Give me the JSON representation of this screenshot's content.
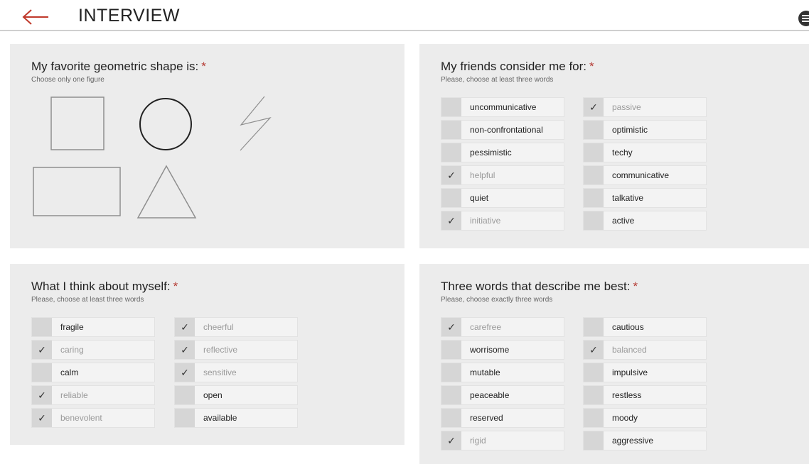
{
  "header": {
    "title": "INTERVIEW",
    "back_icon": "arrow-left-icon",
    "menu_icon": "menu-icon",
    "accent_color": "#c0392b"
  },
  "shape_card": {
    "title": "My favorite geometric shape is:",
    "required_mark": "*",
    "subtitle": "Choose only one figure",
    "shapes": [
      "square",
      "circle",
      "zigzag",
      "rectangle",
      "triangle"
    ],
    "selected": "circle"
  },
  "friends_card": {
    "title": "My friends consider me for:",
    "required_mark": "*",
    "subtitle": "Please, choose at least three words",
    "options": [
      {
        "label": "uncommunicative",
        "checked": false
      },
      {
        "label": "non-confrontational",
        "checked": false
      },
      {
        "label": "pessimistic",
        "checked": false
      },
      {
        "label": "helpful",
        "checked": true
      },
      {
        "label": "quiet",
        "checked": false
      },
      {
        "label": "initiative",
        "checked": true
      },
      {
        "label": "passive",
        "checked": true
      },
      {
        "label": "optimistic",
        "checked": false
      },
      {
        "label": "techy",
        "checked": false
      },
      {
        "label": "communicative",
        "checked": false
      },
      {
        "label": "talkative",
        "checked": false
      },
      {
        "label": "active",
        "checked": false
      }
    ]
  },
  "myself_card": {
    "title": "What I think about myself:",
    "required_mark": "*",
    "subtitle": "Please, choose at least three words",
    "options": [
      {
        "label": "fragile",
        "checked": false
      },
      {
        "label": "caring",
        "checked": true
      },
      {
        "label": "calm",
        "checked": false
      },
      {
        "label": "reliable",
        "checked": true
      },
      {
        "label": "benevolent",
        "checked": true
      },
      {
        "label": "cheerful",
        "checked": true
      },
      {
        "label": "reflective",
        "checked": true
      },
      {
        "label": "sensitive",
        "checked": true
      },
      {
        "label": "open",
        "checked": false
      },
      {
        "label": "available",
        "checked": false
      }
    ]
  },
  "three_words_card": {
    "title": "Three words that describe me best:",
    "required_mark": "*",
    "subtitle": "Please, choose exactly three words",
    "options": [
      {
        "label": "carefree",
        "checked": true
      },
      {
        "label": "worrisome",
        "checked": false
      },
      {
        "label": "mutable",
        "checked": false
      },
      {
        "label": "peaceable",
        "checked": false
      },
      {
        "label": "reserved",
        "checked": false
      },
      {
        "label": "rigid",
        "checked": true
      },
      {
        "label": "cautious",
        "checked": false
      },
      {
        "label": "balanced",
        "checked": true
      },
      {
        "label": "impulsive",
        "checked": false
      },
      {
        "label": "restless",
        "checked": false
      },
      {
        "label": "moody",
        "checked": false
      },
      {
        "label": "aggressive",
        "checked": false
      }
    ]
  },
  "check_glyph": "✓"
}
